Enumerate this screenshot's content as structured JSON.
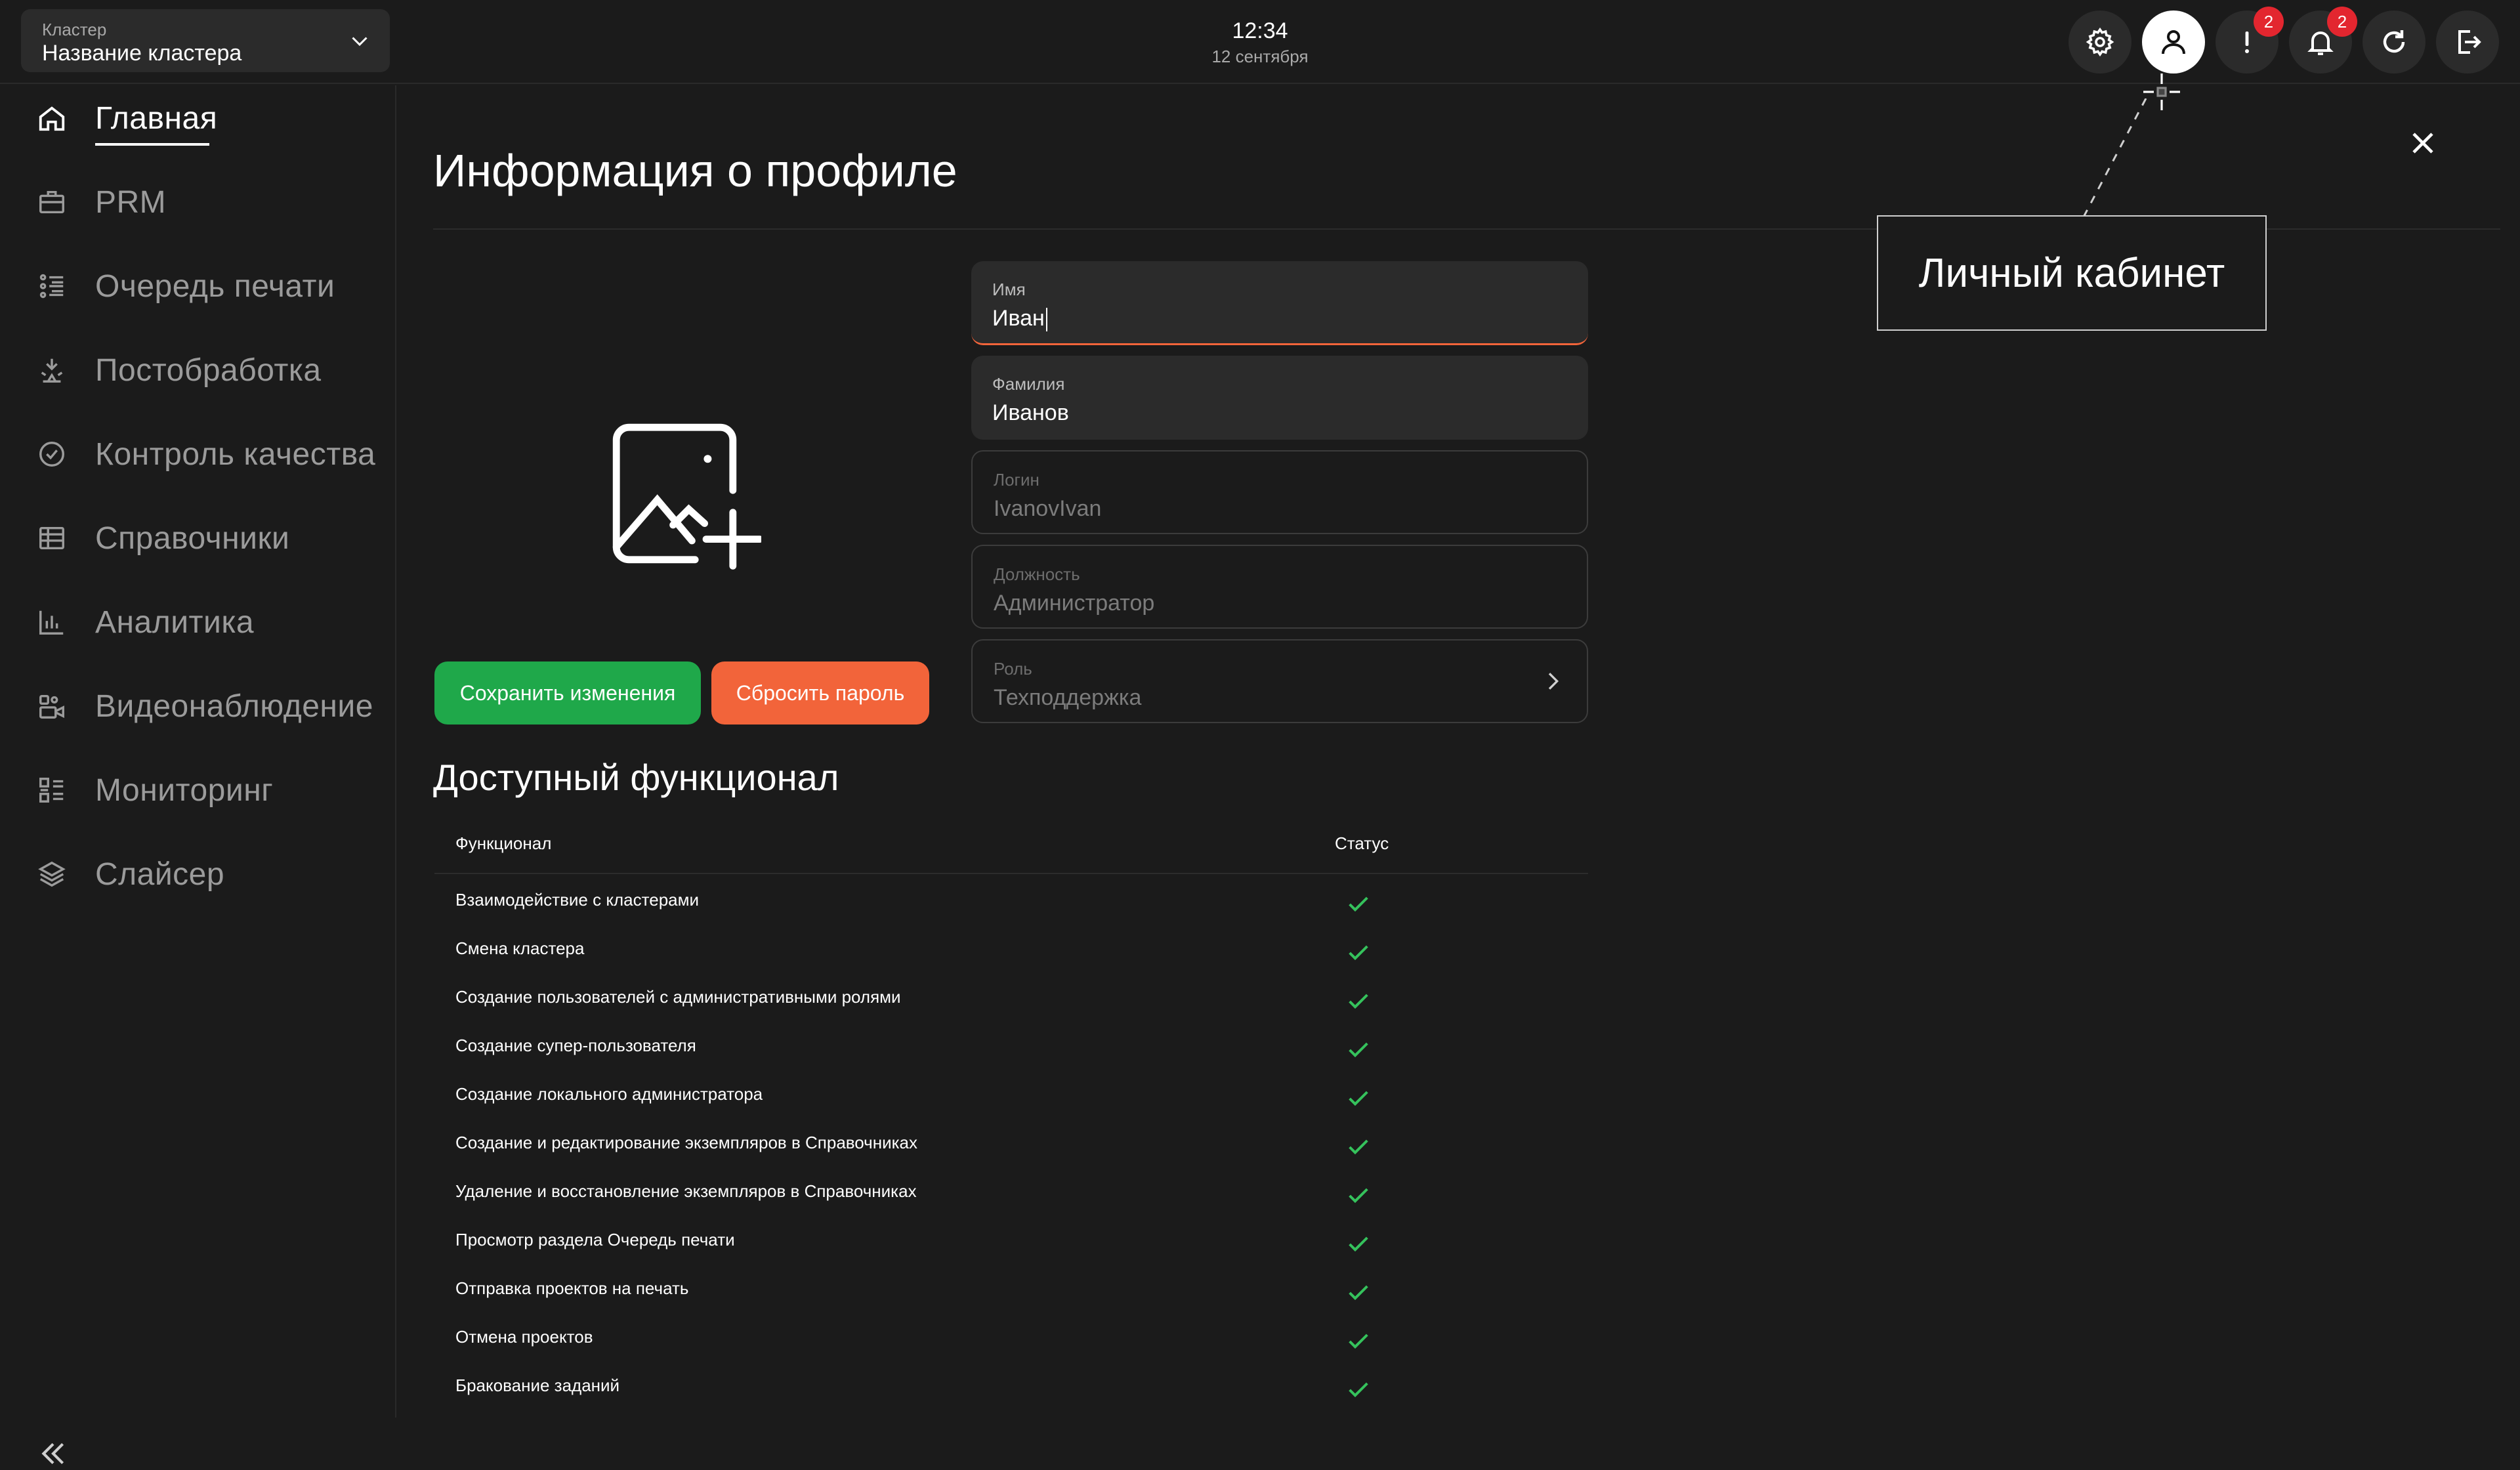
{
  "header": {
    "cluster_label": "Кластер",
    "cluster_value": "Название кластера",
    "time": "12:34",
    "date": "12 сентября",
    "alerts_badge": "2",
    "notifications_badge": "2"
  },
  "sidebar": {
    "items": [
      {
        "label": "Главная",
        "icon": "home-icon",
        "active": true
      },
      {
        "label": "PRM",
        "icon": "briefcase-icon"
      },
      {
        "label": "Очередь печати",
        "icon": "queue-icon"
      },
      {
        "label": "Постобработка",
        "icon": "postprocess-icon"
      },
      {
        "label": "Контроль качества",
        "icon": "check-circle-icon"
      },
      {
        "label": "Справочники",
        "icon": "table-icon"
      },
      {
        "label": "Аналитика",
        "icon": "bar-chart-icon"
      },
      {
        "label": "Видеонаблюдение",
        "icon": "camera-icon"
      },
      {
        "label": "Мониторинг",
        "icon": "monitoring-icon"
      },
      {
        "label": "Слайсер",
        "icon": "layers-icon"
      }
    ]
  },
  "profile": {
    "title": "Информация о профиле",
    "save_label": "Сохранить изменения",
    "reset_label": "Сбросить пароль",
    "fields": {
      "first_name": {
        "label": "Имя",
        "value": "Иван"
      },
      "last_name": {
        "label": "Фамилия",
        "value": "Иванов"
      },
      "login": {
        "label": "Логин",
        "value": "IvanovIvan"
      },
      "position": {
        "label": "Должность",
        "value": "Администратор"
      },
      "role": {
        "label": "Роль",
        "value": "Техподдержка"
      }
    }
  },
  "features": {
    "title": "Доступный функционал",
    "col_feature": "Функционал",
    "col_status": "Статус",
    "rows": [
      "Взаимодействие с кластерами",
      "Смена кластера",
      "Создание пользователей с административными ролями",
      "Создание супер-пользователя",
      "Создание локального администратора",
      "Создание и редактирование экземпляров в Справочниках",
      "Удаление и восстановление экземпляров в Справочниках",
      "Просмотр раздела Очередь печати",
      "Отправка проектов на печать",
      "Отмена проектов",
      "Бракование заданий"
    ],
    "status_color": "#35c25c"
  },
  "tooltip": {
    "text": "Личный кабинет"
  },
  "colors": {
    "save": "#1fa84a",
    "reset": "#f2643a",
    "badge": "#e3262f",
    "background": "#1b1b1b"
  }
}
